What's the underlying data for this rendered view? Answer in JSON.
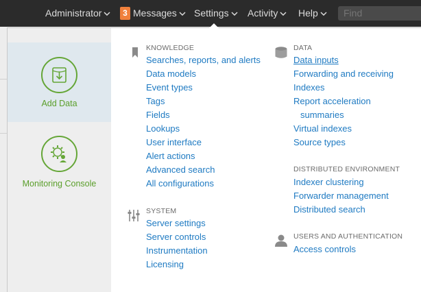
{
  "topbar": {
    "administrator": "Administrator",
    "messages_count": "3",
    "messages": "Messages",
    "settings": "Settings",
    "activity": "Activity",
    "help": "Help",
    "find_placeholder": "Find"
  },
  "apps": [
    {
      "label": "Add Data",
      "icon": "download-icon"
    },
    {
      "label": "Monitoring Console",
      "icon": "gear-person-icon"
    }
  ],
  "knowledge": {
    "heading": "KNOWLEDGE",
    "icon": "bookmark-icon",
    "items": [
      "Searches, reports, and alerts",
      "Data models",
      "Event types",
      "Tags",
      "Fields",
      "Lookups",
      "User interface",
      "Alert actions",
      "Advanced search",
      "All configurations"
    ]
  },
  "system": {
    "heading": "SYSTEM",
    "icon": "sliders-icon",
    "items": [
      "Server settings",
      "Server controls",
      "Instrumentation",
      "Licensing"
    ]
  },
  "data": {
    "heading": "DATA",
    "icon": "database-icon",
    "items": [
      "Data inputs",
      "Forwarding and receiving",
      "Indexes",
      "Report acceleration",
      "summaries",
      "Virtual indexes",
      "Source types"
    ]
  },
  "distributed": {
    "heading": "DISTRIBUTED ENVIRONMENT",
    "items": [
      "Indexer clustering",
      "Forwarder management",
      "Distributed search"
    ]
  },
  "users": {
    "heading": "USERS AND AUTHENTICATION",
    "icon": "user-icon",
    "items": [
      "Access controls"
    ]
  },
  "colors": {
    "topbar": "#2b2b2b",
    "link": "#1e7ac2",
    "app_green": "#65a637",
    "badge": "#f0803c"
  }
}
